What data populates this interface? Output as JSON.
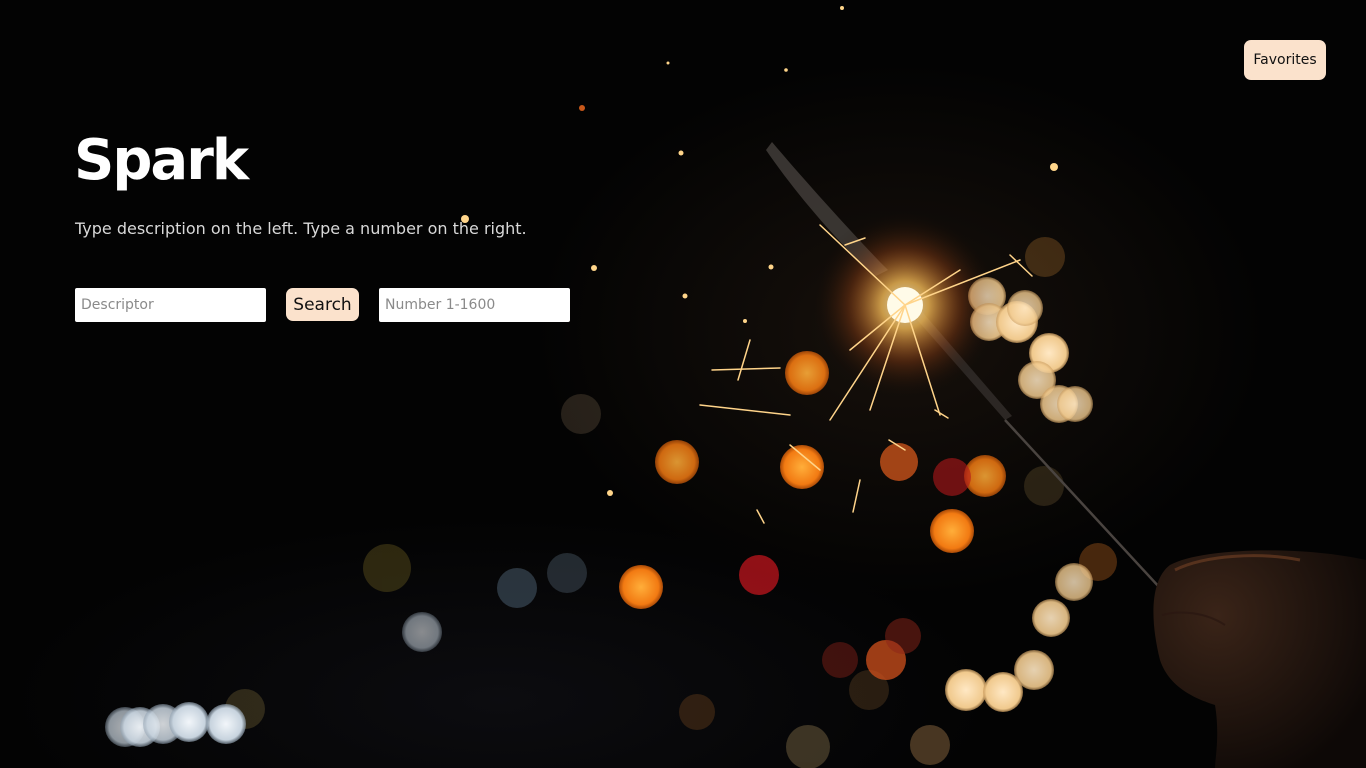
{
  "app": {
    "title": "Spark",
    "subtitle": "Type description on the left. Type a number on the right."
  },
  "header": {
    "favorites_label": "Favorites"
  },
  "search": {
    "descriptor_placeholder": "Descriptor",
    "descriptor_value": "",
    "search_label": "Search",
    "number_placeholder": "Number 1-1600",
    "number_value": ""
  },
  "background": {
    "subject": "sparkler-bokeh-icon"
  },
  "colors": {
    "button_bg": "#fbe2cc",
    "page_bg": "#030303",
    "title_text": "#ffffff",
    "subtitle_text": "#d9d9d9"
  }
}
